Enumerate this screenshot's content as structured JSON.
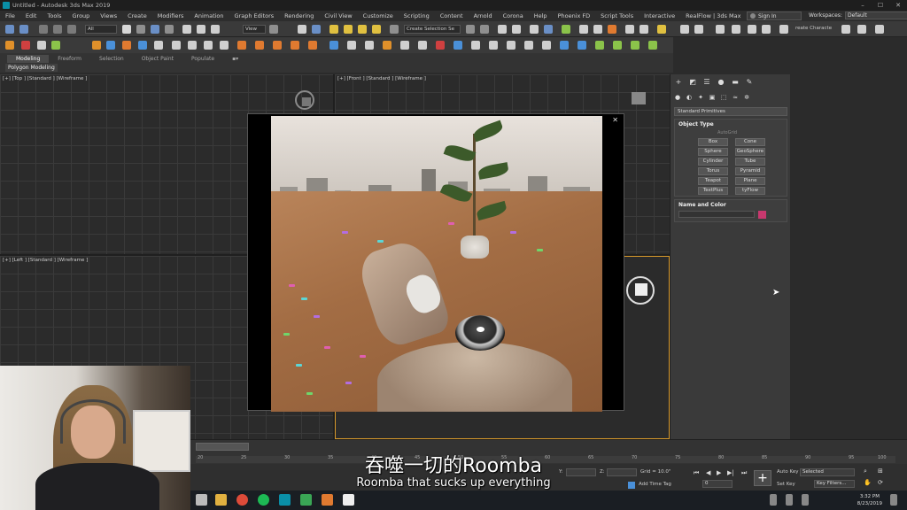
{
  "window": {
    "title": "Untitled - Autodesk 3ds Max 2019",
    "controls": [
      "–",
      "☐",
      "✕"
    ]
  },
  "menu": {
    "items": [
      "File",
      "Edit",
      "Tools",
      "Group",
      "Views",
      "Create",
      "Modifiers",
      "Animation",
      "Graph Editors",
      "Rendering",
      "Civil View",
      "Customize",
      "Scripting",
      "Content",
      "Arnold",
      "Corona",
      "Help",
      "Phoenix FD",
      "Script Tools",
      "Interactive",
      "RealFlow | 3ds Max"
    ],
    "sign_in": "Sign In",
    "workspaces_label": "Workspaces:",
    "workspaces_value": "Default"
  },
  "toolbar": {
    "filter_value": "All",
    "view_value": "View",
    "selection_set": "Create Selection Se",
    "create_character": "reate Characte"
  },
  "ribbon": {
    "tabs": [
      "Modeling",
      "Freeform",
      "Selection",
      "Object Paint",
      "Populate"
    ],
    "sub_label": "Polygon Modeling"
  },
  "viewports": {
    "top": "[+] [Top ] [Standard ] [Wireframe ]",
    "front": "[+] [Front ] [Standard ] [Wireframe ]",
    "left": "[+] [Left ] [Standard ] [Wireframe ]"
  },
  "command_panel": {
    "category": "Standard Primitives",
    "object_type_title": "Object Type",
    "autogrid": "AutoGrid",
    "buttons": [
      [
        "Box",
        "Cone"
      ],
      [
        "Sphere",
        "GeoSphere"
      ],
      [
        "Cylinder",
        "Tube"
      ],
      [
        "Torus",
        "Pyramid"
      ],
      [
        "Teapot",
        "Plane"
      ],
      [
        "TextPlus",
        "tyFlow"
      ]
    ],
    "name_color_title": "Name and Color",
    "swatch_color": "#c8386e"
  },
  "image_window": {
    "controls": [
      "–",
      "☐",
      "✕"
    ]
  },
  "timeline": {
    "ticks": [
      "20",
      "25",
      "30",
      "35",
      "40",
      "45",
      "50",
      "55",
      "60",
      "65",
      "70",
      "75",
      "80",
      "85",
      "90",
      "95",
      "100"
    ]
  },
  "status": {
    "y_label": "Y:",
    "z_label": "Z:",
    "grid": "Grid = 10.0\"",
    "add_time_tag": "Add Time Tag",
    "auto_key": "Auto Key",
    "selected": "Selected",
    "set_key": "Set Key",
    "key_filters": "Key Filters...",
    "frame_value": "0"
  },
  "taskbar": {
    "time": "3:32 PM",
    "date": "8/23/2019"
  },
  "subtitles": {
    "zh": "吞噬一切的Roomba",
    "en": "Roomba that sucks up everything"
  }
}
